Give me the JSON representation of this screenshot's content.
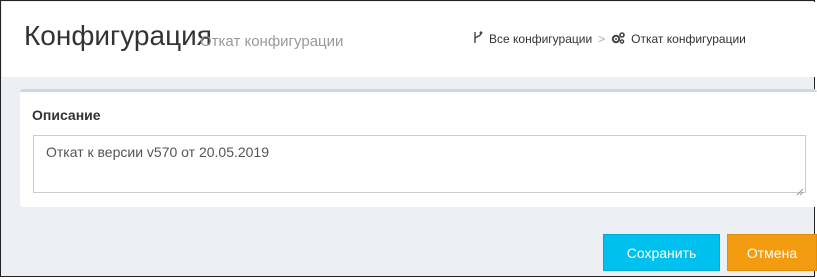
{
  "header": {
    "title": "Конфигурация",
    "subtitle": "Откат конфигурации"
  },
  "breadcrumb": {
    "items": [
      {
        "label": "Все конфигурации",
        "icon": "branch-icon"
      },
      {
        "label": "Откат конфигурации",
        "icon": "gears-icon"
      }
    ],
    "separator": ">"
  },
  "description_box": {
    "label": "Описание",
    "value": "Откат к версии v570 от 20.05.2019"
  },
  "actions": {
    "save_label": "Сохранить",
    "cancel_label": "Отмена"
  },
  "colors": {
    "save": "#00c0ef",
    "cancel": "#f39c12",
    "background": "#ecf0f5"
  }
}
